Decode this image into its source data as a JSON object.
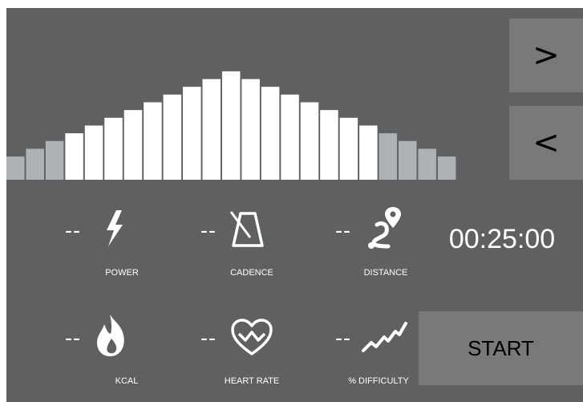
{
  "workout_profile": {
    "levels": [
      3,
      4,
      5,
      6,
      7,
      8,
      9,
      10,
      11,
      12,
      13,
      14,
      13,
      12,
      11,
      10,
      9,
      8,
      7,
      6,
      5,
      4,
      3
    ],
    "active_from": 3,
    "active_to": 18,
    "max_level": 14,
    "colors": {
      "active": "#ffffff",
      "inactive": "#aeb1b6"
    }
  },
  "nav": {
    "next_label": ">",
    "prev_label": "<"
  },
  "metrics": [
    {
      "id": "power",
      "value": "--",
      "label": "POWER",
      "icon": "lightning-bolt-icon"
    },
    {
      "id": "cadence",
      "value": "--",
      "label": "CADENCE",
      "icon": "metronome-icon"
    },
    {
      "id": "distance",
      "value": "--",
      "label": "DISTANCE",
      "icon": "route-pin-icon"
    },
    {
      "id": "kcal",
      "value": "--",
      "label": "KCAL",
      "icon": "flame-icon"
    },
    {
      "id": "heart_rate",
      "value": "--",
      "label": "HEART RATE",
      "icon": "heart-pulse-icon"
    },
    {
      "id": "difficulty",
      "value": "--",
      "label": "% DIFFICULTY",
      "icon": "trend-line-icon"
    }
  ],
  "timer": {
    "value": "00:25:00"
  },
  "start_button": {
    "label": "START"
  },
  "theme": {
    "background": "#5f6062",
    "button": "#78797b",
    "text": "#ffffff"
  }
}
